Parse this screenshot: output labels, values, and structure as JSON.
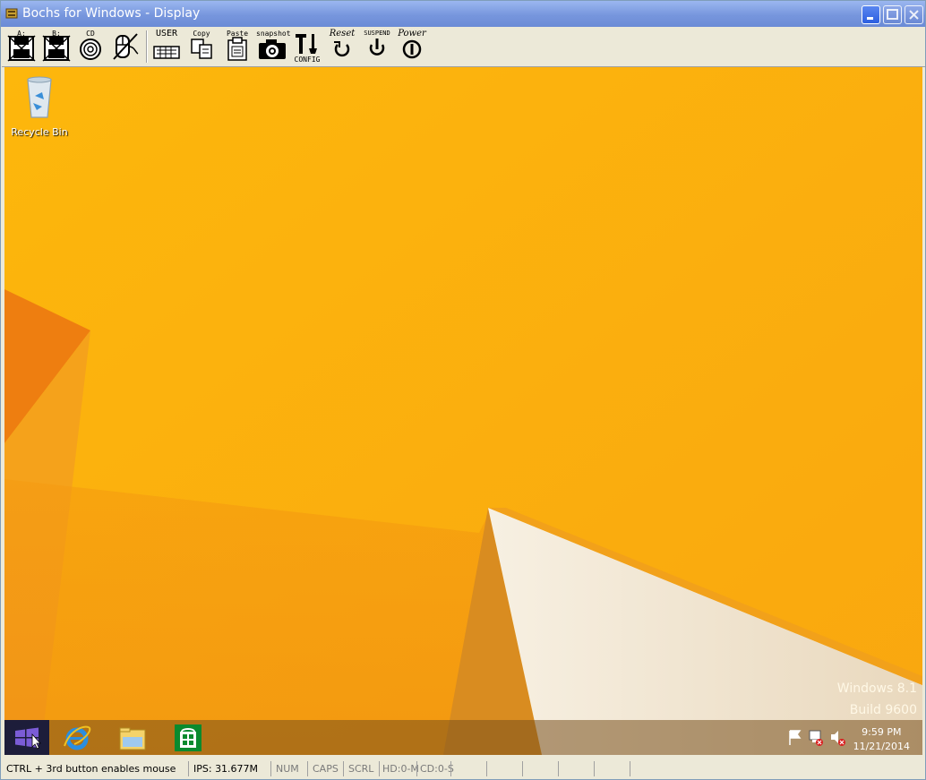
{
  "window": {
    "title": "Bochs for Windows - Display"
  },
  "toolbar": {
    "floppy_a": "A:",
    "floppy_b": "B:",
    "cdrom": "CD",
    "user": "USER",
    "copy": "Copy",
    "paste": "Paste",
    "snapshot": "snapshot",
    "config": "CONFIG",
    "reset": "Reset",
    "suspend": "SUSPEND",
    "power": "Power"
  },
  "desktop": {
    "recycle_bin": "Recycle Bin",
    "watermark_line1": "Windows 8.1",
    "watermark_line2": "Build 9600"
  },
  "taskbar": {
    "clock_time": "9:59 PM",
    "clock_date": "11/21/2014"
  },
  "statusbar": {
    "hint": "CTRL + 3rd button enables mouse",
    "ips": "IPS: 31.677M",
    "num": "NUM",
    "caps": "CAPS",
    "scrl": "SCRL",
    "hd": "HD:0-M",
    "cd": "CD:0-S"
  }
}
